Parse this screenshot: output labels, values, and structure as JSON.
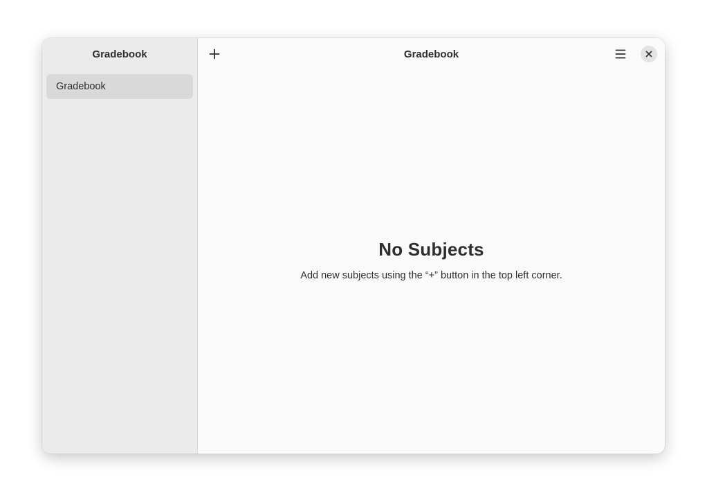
{
  "sidebar": {
    "title": "Gradebook",
    "items": [
      {
        "label": "Gradebook",
        "selected": true
      }
    ]
  },
  "header": {
    "title": "Gradebook",
    "add_icon": "plus-icon",
    "menu_icon": "hamburger-menu-icon",
    "close_icon": "close-icon"
  },
  "empty_state": {
    "title": "No Subjects",
    "description": "Add new subjects using the “+” button in the top left corner."
  },
  "colors": {
    "sidebar_bg": "#ebebeb",
    "content_bg": "#fafafa",
    "selected_item_bg": "#d9d9d9",
    "text": "#2e2e2e"
  }
}
